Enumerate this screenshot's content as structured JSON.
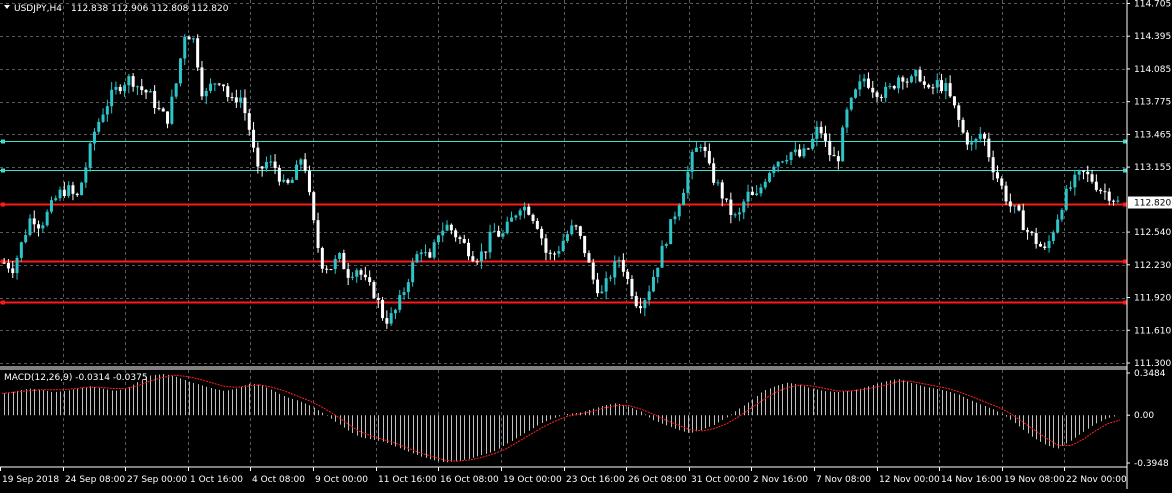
{
  "header": {
    "symbol_label": "USDJPY,H4",
    "ohlc_label": "112.838 112.906 112.808 112.820",
    "menu_arrow": "chevron-down-icon"
  },
  "macd_header": {
    "label": "MACD(12,26,9) -0.0314 -0.0375"
  },
  "colors": {
    "background": "#000000",
    "grid": "#5a5a5a",
    "bull_candle": "#2ec4c8",
    "bear_candle": "#ffffff",
    "hline_cyan": "#40e0d0",
    "hline_red": "#ff1a1a",
    "macd_hist": "#c0c0c0",
    "macd_signal": "#ff2020",
    "axis_text": "#ffffff",
    "price_tag_bg": "#ffffff",
    "price_tag_text": "#000000"
  },
  "chart_data": [
    {
      "type": "candlestick",
      "title": "USDJPY,H4",
      "ylim": [
        111.3,
        114.7
      ],
      "y_ticks": [
        {
          "value": 114.705,
          "label": "114.705"
        },
        {
          "value": 114.395,
          "label": "114.395"
        },
        {
          "value": 114.085,
          "label": "114.085"
        },
        {
          "value": 113.775,
          "label": "113.775"
        },
        {
          "value": 113.465,
          "label": "113.465"
        },
        {
          "value": 113.155,
          "label": "113.155"
        },
        {
          "value": 112.54,
          "label": "112.540"
        },
        {
          "value": 112.23,
          "label": "112.230"
        },
        {
          "value": 111.92,
          "label": "111.920"
        },
        {
          "value": 111.61,
          "label": "111.610"
        },
        {
          "value": 111.3,
          "label": "111.300"
        }
      ],
      "current_price": {
        "value": 112.82,
        "label": "112.820"
      },
      "x_labels": [
        "19 Sep 2018",
        "24 Sep 08:00",
        "27 Sep 00:00",
        "1 Oct 16:00",
        "4 Oct 08:00",
        "9 Oct 00:00",
        "11 Oct 16:00",
        "16 Oct 08:00",
        "19 Oct 00:00",
        "23 Oct 16:00",
        "26 Oct 08:00",
        "31 Oct 00:00",
        "2 Nov 16:00",
        "7 Nov 08:00",
        "12 Nov 00:00",
        "14 Nov 16:00",
        "19 Nov 08:00",
        "22 Nov 00:00"
      ],
      "close_path": [
        112.25,
        112.2,
        112.45,
        112.7,
        112.6,
        112.75,
        112.9,
        112.95,
        112.85,
        113.15,
        113.5,
        113.7,
        113.85,
        113.95,
        114.0,
        113.9,
        113.85,
        113.7,
        113.6,
        113.95,
        114.45,
        114.35,
        113.8,
        113.95,
        114.0,
        113.75,
        113.85,
        113.55,
        113.1,
        113.2,
        113.15,
        112.95,
        113.05,
        113.3,
        112.7,
        112.25,
        112.2,
        112.3,
        112.15,
        112.2,
        112.05,
        111.95,
        111.7,
        111.75,
        111.95,
        112.2,
        112.4,
        112.25,
        112.55,
        112.6,
        112.5,
        112.4,
        112.3,
        112.35,
        112.55,
        112.5,
        112.65,
        112.8,
        112.75,
        112.6,
        112.3,
        112.35,
        112.5,
        112.6,
        112.4,
        112.1,
        111.95,
        112.15,
        112.3,
        112.05,
        111.85,
        111.95,
        112.2,
        112.45,
        112.7,
        112.95,
        113.25,
        113.4,
        113.1,
        112.95,
        112.75,
        112.65,
        112.9,
        112.85,
        113.05,
        113.2,
        113.25,
        113.3,
        113.25,
        113.35,
        113.55,
        113.3,
        113.2,
        113.65,
        113.85,
        114.0,
        113.9,
        113.85,
        113.9,
        114.05,
        113.95,
        114.05,
        113.85,
        113.95,
        113.9,
        113.7,
        113.45,
        113.35,
        113.5,
        113.2,
        113.0,
        112.8,
        112.7,
        112.55,
        112.45,
        112.35,
        112.6,
        112.85,
        113.0,
        113.1,
        113.05,
        112.95,
        112.9,
        112.82
      ],
      "horizontal_lines": [
        {
          "value": 113.4,
          "style": "cyan"
        },
        {
          "value": 113.13,
          "style": "cyan"
        },
        {
          "value": 112.81,
          "style": "red"
        },
        {
          "value": 112.27,
          "style": "red"
        },
        {
          "value": 111.88,
          "style": "red"
        }
      ]
    },
    {
      "type": "macd",
      "title": "MACD(12,26,9)",
      "ylim": [
        -0.3948,
        0.3484
      ],
      "y_ticks": [
        {
          "value": 0.3484,
          "label": "0.3484"
        },
        {
          "value": 0.0,
          "label": "0.00"
        },
        {
          "value": -0.3948,
          "label": "-0.3948"
        }
      ],
      "histogram_path": [
        0.18,
        0.2,
        0.22,
        0.21,
        0.19,
        0.2,
        0.22,
        0.24,
        0.22,
        0.2,
        0.22,
        0.28,
        0.33,
        0.34,
        0.32,
        0.28,
        0.25,
        0.22,
        0.2,
        0.22,
        0.26,
        0.25,
        0.2,
        0.15,
        0.12,
        0.08,
        0.02,
        -0.05,
        -0.12,
        -0.18,
        -0.2,
        -0.22,
        -0.26,
        -0.3,
        -0.34,
        -0.37,
        -0.39,
        -0.38,
        -0.36,
        -0.33,
        -0.3,
        -0.24,
        -0.18,
        -0.12,
        -0.06,
        -0.02,
        0.01,
        0.02,
        0.05,
        0.08,
        0.1,
        0.07,
        0.03,
        -0.04,
        -0.08,
        -0.12,
        -0.15,
        -0.12,
        -0.08,
        -0.02,
        0.05,
        0.12,
        0.2,
        0.24,
        0.27,
        0.25,
        0.22,
        0.2,
        0.19,
        0.2,
        0.22,
        0.25,
        0.28,
        0.3,
        0.27,
        0.24,
        0.22,
        0.2,
        0.17,
        0.12,
        0.08,
        0.04,
        -0.02,
        -0.1,
        -0.18,
        -0.24,
        -0.28,
        -0.22,
        -0.15,
        -0.08,
        -0.03,
        0.0
      ],
      "signal_path": [
        0.18,
        0.19,
        0.2,
        0.21,
        0.21,
        0.21,
        0.22,
        0.23,
        0.23,
        0.22,
        0.22,
        0.24,
        0.28,
        0.31,
        0.33,
        0.32,
        0.3,
        0.27,
        0.24,
        0.23,
        0.24,
        0.25,
        0.23,
        0.2,
        0.16,
        0.12,
        0.07,
        0.01,
        -0.06,
        -0.13,
        -0.17,
        -0.2,
        -0.23,
        -0.27,
        -0.31,
        -0.34,
        -0.37,
        -0.38,
        -0.37,
        -0.35,
        -0.32,
        -0.28,
        -0.22,
        -0.16,
        -0.1,
        -0.05,
        -0.01,
        0.01,
        0.03,
        0.06,
        0.08,
        0.08,
        0.05,
        0.01,
        -0.04,
        -0.08,
        -0.12,
        -0.13,
        -0.11,
        -0.07,
        -0.01,
        0.06,
        0.13,
        0.19,
        0.23,
        0.25,
        0.24,
        0.22,
        0.2,
        0.2,
        0.21,
        0.23,
        0.25,
        0.28,
        0.28,
        0.26,
        0.24,
        0.22,
        0.19,
        0.15,
        0.11,
        0.07,
        0.02,
        -0.05,
        -0.12,
        -0.19,
        -0.25,
        -0.25,
        -0.2,
        -0.13,
        -0.07,
        -0.04
      ]
    }
  ]
}
